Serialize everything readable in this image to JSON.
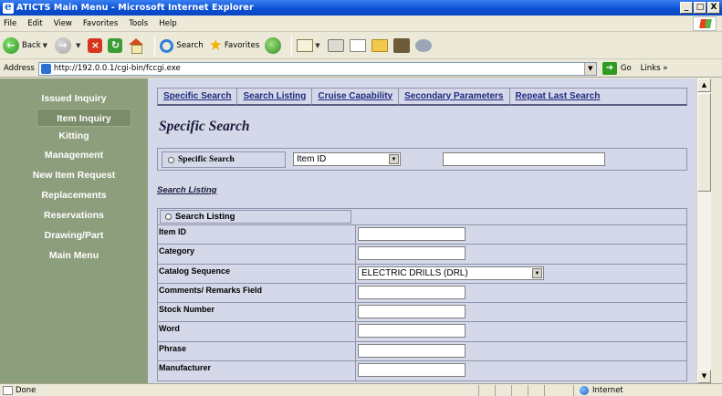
{
  "window": {
    "title": "ATICTS Main Menu - Microsoft Internet Explorer",
    "buttons": [
      "_",
      "□",
      "X"
    ]
  },
  "menubar": [
    "File",
    "Edit",
    "View",
    "Favorites",
    "Tools",
    "Help"
  ],
  "toolbar": {
    "back_label": "Back",
    "search_label": "Search",
    "favorites_label": "Favorites"
  },
  "addressbar": {
    "label": "Address",
    "url": "http://192.0.0.1/cgi-bin/fccgi.exe",
    "go_label": "Go",
    "links_label": "Links »"
  },
  "leftnav": {
    "items": [
      {
        "label": "Issued Inquiry"
      },
      {
        "label": "Item Inquiry"
      },
      {
        "label": "Kitting"
      },
      {
        "label": "Management"
      },
      {
        "label": "New Item Request"
      },
      {
        "label": "Replacements"
      },
      {
        "label": "Reservations"
      },
      {
        "label": "Drawing/Part"
      },
      {
        "label": "Main Menu"
      }
    ]
  },
  "tabs": [
    "Specific Search",
    "Search Listing",
    "Cruise Capability",
    "Secondary Parameters",
    "Repeat Last Search"
  ],
  "page_title": "Specific Search",
  "specific_search": {
    "radio_label": "Specific Search",
    "select_value": "Item ID",
    "input_value": ""
  },
  "search_listing_link": "Search Listing",
  "search_listing": {
    "radio_label": "Search Listing",
    "rows": [
      {
        "label": "Item ID",
        "value": ""
      },
      {
        "label": "Category",
        "value": ""
      },
      {
        "label": "Catalog Sequence",
        "value": "ELECTRIC DRILLS (DRL)"
      },
      {
        "label": "Comments/ Remarks Field",
        "value": ""
      },
      {
        "label": "Stock Number",
        "value": ""
      },
      {
        "label": "Word",
        "value": ""
      },
      {
        "label": "Phrase",
        "value": ""
      },
      {
        "label": "Manufacturer",
        "value": ""
      }
    ]
  },
  "statusbar": {
    "status": "Done",
    "zone": "Internet"
  },
  "colors": {
    "nav_bg": "#8d9e7d",
    "main_bg": "#d4d8e8",
    "tab_link": "#1f2a80",
    "titlebar": "#0a4fd0"
  }
}
